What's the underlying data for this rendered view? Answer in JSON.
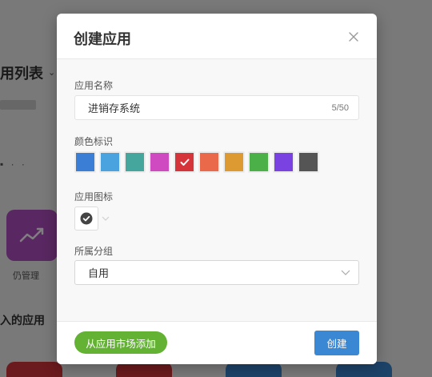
{
  "background": {
    "page_title": "用列表",
    "page_title_arrow": "⌄",
    "app_tile_label": "仍管理",
    "section_title": "入的应用",
    "tile_colors": [
      "#d6343b",
      "#d6343b",
      "#3a87d3",
      "#3a87d3"
    ]
  },
  "modal": {
    "title": "创建应用",
    "close_icon": "close-icon",
    "name_field": {
      "label": "应用名称",
      "value": "进销存系统",
      "counter": "5/50"
    },
    "color_field": {
      "label": "颜色标识",
      "colors": [
        "#3a7fd5",
        "#4aa3de",
        "#44a69c",
        "#cf49c0",
        "#d6343b",
        "#e9694a",
        "#dd9a33",
        "#4bb047",
        "#7a42e0",
        "#555555"
      ],
      "selected_index": 4
    },
    "icon_field": {
      "label": "应用图标",
      "selected_icon": "check-circle-icon"
    },
    "group_field": {
      "label": "所属分组",
      "value": "自用"
    },
    "footer": {
      "market_button": "从应用市场添加",
      "create_button": "创建"
    }
  }
}
